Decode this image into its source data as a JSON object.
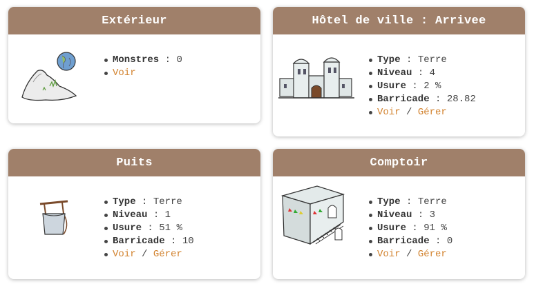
{
  "cards": {
    "exterieur": {
      "title": "Extérieur",
      "stats": [
        {
          "label": "Monstres",
          "value": "0"
        }
      ],
      "links": {
        "view": "Voir"
      }
    },
    "hotel": {
      "title": "Hôtel de ville : Arrivee",
      "stats": [
        {
          "label": "Type",
          "value": "Terre"
        },
        {
          "label": "Niveau",
          "value": "4"
        },
        {
          "label": "Usure",
          "value": "2 %"
        },
        {
          "label": "Barricade",
          "value": "28.82"
        }
      ],
      "links": {
        "view": "Voir",
        "manage": "Gérer"
      }
    },
    "puits": {
      "title": "Puits",
      "stats": [
        {
          "label": "Type",
          "value": "Terre"
        },
        {
          "label": "Niveau",
          "value": "1"
        },
        {
          "label": "Usure",
          "value": "51 %"
        },
        {
          "label": "Barricade",
          "value": "10"
        }
      ],
      "links": {
        "view": "Voir",
        "manage": "Gérer"
      }
    },
    "comptoir": {
      "title": "Comptoir",
      "stats": [
        {
          "label": "Type",
          "value": "Terre"
        },
        {
          "label": "Niveau",
          "value": "3"
        },
        {
          "label": "Usure",
          "value": "91 %"
        },
        {
          "label": "Barricade",
          "value": "0"
        }
      ],
      "links": {
        "view": "Voir",
        "manage": "Gérer"
      }
    }
  },
  "separator": "/",
  "colon": ":",
  "colors": {
    "header": "#a0806a",
    "link": "#d2822e"
  }
}
